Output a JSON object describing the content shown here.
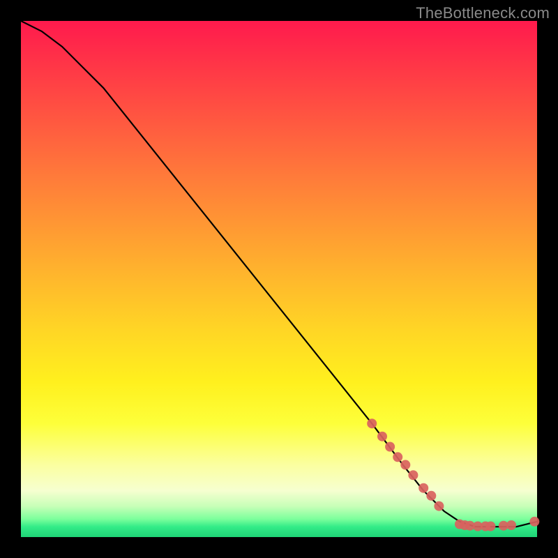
{
  "watermark": "TheBottleneck.com",
  "chart_data": {
    "type": "line",
    "title": "",
    "xlabel": "",
    "ylabel": "",
    "xlim": [
      0,
      100
    ],
    "ylim": [
      0,
      100
    ],
    "grid": false,
    "legend": false,
    "series": [
      {
        "name": "curve",
        "style": "line",
        "color": "#000000",
        "x": [
          0,
          4,
          8,
          12,
          16,
          20,
          28,
          36,
          44,
          52,
          60,
          68,
          74,
          78,
          82,
          85,
          88,
          92,
          96,
          100
        ],
        "y": [
          100,
          98,
          95,
          91,
          87,
          82,
          72,
          62,
          52,
          42,
          32,
          22,
          14,
          9,
          5,
          3,
          2,
          2,
          2,
          3
        ]
      },
      {
        "name": "dots",
        "style": "scatter",
        "color": "#d9625e",
        "x": [
          68,
          70,
          71.5,
          73,
          74.5,
          76,
          78,
          79.5,
          81,
          85,
          86,
          87,
          88.5,
          90,
          91,
          93.5,
          95,
          99.5
        ],
        "y": [
          22,
          19.5,
          17.5,
          15.5,
          14,
          12,
          9.5,
          8,
          6,
          2.5,
          2.3,
          2.2,
          2.1,
          2.1,
          2.1,
          2.2,
          2.3,
          3
        ]
      }
    ]
  }
}
